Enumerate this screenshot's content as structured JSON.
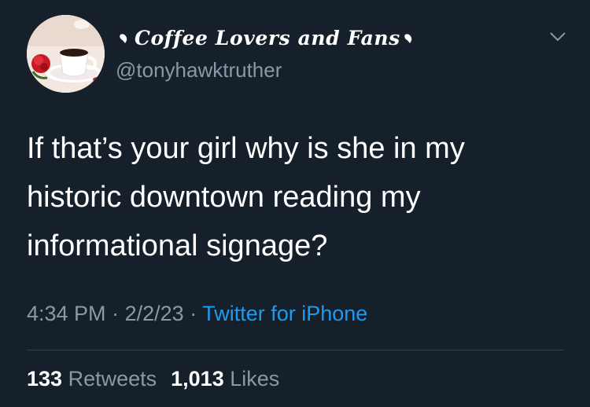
{
  "tweet": {
    "display_name": "Coffee Lovers and Fans",
    "handle": "@tonyhawktruther",
    "text": "If that’s your girl why is she in my historic downtown reading my informational signage?",
    "time": "4:34 PM",
    "date": "2/2/23",
    "source": "Twitter for iPhone",
    "separator": "·",
    "retweets_count": "133",
    "retweets_label": "Retweets",
    "likes_count": "1,013",
    "likes_label": "Likes"
  },
  "icons": {
    "avatar": "coffee-cup-rose-avatar",
    "name_decoration": "heart-arrow-icon",
    "menu": "chevron-down-icon"
  },
  "colors": {
    "background": "#15202b",
    "primary_text": "#ffffff",
    "secondary_text": "#8b98a5",
    "link": "#1d9bf0",
    "divider": "#38444d"
  }
}
